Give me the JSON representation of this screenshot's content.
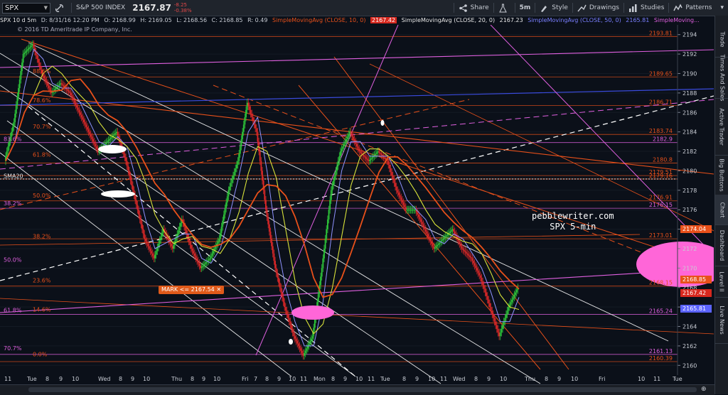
{
  "topbar": {
    "symbol": "SPX",
    "link_icon": "link-icon",
    "description": "S&P 500 INDEX",
    "last": "2167.87",
    "change": "-8.25",
    "change_pct": "-0.38%",
    "share_label": "Share",
    "flask_icon": "flask-icon",
    "timeframe": "5m",
    "style_label": "Style",
    "drawings_label": "Drawings",
    "studies_label": "Studies",
    "patterns_label": "Patterns"
  },
  "studyline": {
    "header": "SPX 10 d 5m",
    "date": "D: 8/31/16 12:20 PM",
    "open": "O: 2168.99",
    "high": "H: 2169.05",
    "low": "L: 2168.56",
    "close": "C: 2168.85",
    "range": "R: 0.49",
    "sma10_label": "SimpleMovingAvg (CLOSE, 10, 0)",
    "sma10_value": "2167.42",
    "sma20_label": "SimpleMovingAvg (CLOSE, 20, 0)",
    "sma20_value": "2167.23",
    "sma50_label": "SimpleMovingAvg (CLOSE, 50, 0)",
    "sma50_value": "2165.81",
    "sma_more": "SimpleMoving..."
  },
  "copyright": "© 2016 TD Ameritrade IP Company, Inc.",
  "watermark": {
    "line1": "pebblewriter.com",
    "line2": "SPX 5-min"
  },
  "mark": {
    "label": "MARK <= 2167.54"
  },
  "badges": [
    {
      "text": "2174.04",
      "color": "#e8501a",
      "y": 2174.04
    },
    {
      "text": "2168.85",
      "color": "#e8501a",
      "y": 2168.85
    },
    {
      "text": "2167.42",
      "color": "#d7281e",
      "y": 2167.42
    },
    {
      "text": "2165.81",
      "color": "#5b63ff",
      "y": 2165.81
    }
  ],
  "right_tabs": [
    "Trade",
    "Times And Sales",
    "Active Trader",
    "Big Buttons",
    "Chart",
    "Dashboard",
    "Level II",
    "Live News"
  ],
  "colors": {
    "background": "#0b1019",
    "bullish": "#2ec93a",
    "bearish": "#e02828",
    "sma10": "#d8e23a",
    "sma20": "#e8501a",
    "sma50": "#6b6ff0",
    "fib": "#e8501a",
    "channel_white": "#ffffff",
    "magenta": "#e060e0"
  },
  "chart_data": {
    "type": "line",
    "title": "SPX 10 d 5m",
    "ylim": [
      2159,
      2195
    ],
    "y_ticks": [
      2160,
      2162,
      2164,
      2166,
      2168,
      2170,
      2172,
      2174,
      2176,
      2178,
      2180,
      2182,
      2184,
      2186,
      2188,
      2190,
      2192,
      2194
    ],
    "x_tick_labels": [
      "11",
      "Tue",
      "8",
      "9",
      "10",
      "Wed",
      "8",
      "9",
      "10",
      "Thu",
      "8",
      "9",
      "10",
      "Fri",
      "7",
      "8",
      "9",
      "10",
      "11",
      "Mon",
      "8",
      "9",
      "10",
      "11",
      "Tue",
      "8",
      "9",
      "10",
      "11",
      "Wed",
      "8",
      "9",
      "10",
      "Thu",
      "8",
      "9",
      "10",
      "Fri",
      "10",
      "11",
      "Tue"
    ],
    "series": [
      {
        "name": "SPX",
        "values": [
          2181,
          2185,
          2192,
          2193,
          2190,
          2188,
          2189,
          2188,
          2186,
          2184,
          2182,
          2183,
          2184,
          2181,
          2177,
          2173,
          2171,
          2174,
          2172,
          2175,
          2172,
          2170,
          2171,
          2173,
          2178,
          2181,
          2187,
          2184,
          2176,
          2170,
          2166,
          2163,
          2161,
          2163,
          2170,
          2178,
          2182,
          2184,
          2182,
          2181,
          2182,
          2181,
          2178,
          2176,
          2176,
          2174,
          2172,
          2173,
          2174,
          2172,
          2171,
          2169,
          2166,
          2163,
          2166,
          2168
        ]
      }
    ],
    "fib_levels_right": [
      {
        "label": "2193.81",
        "y": 2193.81
      },
      {
        "label": "2189.65",
        "y": 2189.65
      },
      {
        "label": "2186.71",
        "y": 2186.71
      },
      {
        "label": "2183.74",
        "y": 2183.74
      },
      {
        "label": "2182.9",
        "y": 2182.9
      },
      {
        "label": "2180.8",
        "y": 2180.8
      },
      {
        "label": "2179.51",
        "y": 2179.51
      },
      {
        "label": "2179.16",
        "y": 2179.16
      },
      {
        "label": "2176.91",
        "y": 2176.91
      },
      {
        "label": "2176.15",
        "y": 2176.15
      },
      {
        "label": "2173.01",
        "y": 2173.01
      },
      {
        "label": "2168.15",
        "y": 2168.15
      },
      {
        "label": "2165.24",
        "y": 2165.24
      },
      {
        "label": "2161.13",
        "y": 2161.13
      },
      {
        "label": "2160.39",
        "y": 2160.39
      }
    ],
    "fib_labels_left": [
      {
        "label": "88.6%",
        "y": 2189.9
      },
      {
        "label": "78.6%",
        "y": 2186.9
      },
      {
        "label": "70.7%",
        "y": 2184.2
      },
      {
        "label": "61.8%",
        "y": 2181.3
      },
      {
        "label": "50.0%",
        "y": 2177.1
      },
      {
        "label": "38.2%",
        "y": 2172.9
      },
      {
        "label": "23.6%",
        "y": 2168.4
      },
      {
        "label": "14.6%",
        "y": 2165.4
      },
      {
        "label": "0.0%",
        "y": 2160.8
      }
    ],
    "fib_labels_far_left": [
      {
        "label": "83.6%",
        "y": 2182.9
      },
      {
        "label": "SMA20",
        "y": 2179.1
      },
      {
        "label": "38.2%",
        "y": 2176.3
      },
      {
        "label": "50.0%",
        "y": 2170.5
      },
      {
        "label": "61.8%",
        "y": 2165.3
      },
      {
        "label": "70.7%",
        "y": 2161.4
      }
    ]
  }
}
